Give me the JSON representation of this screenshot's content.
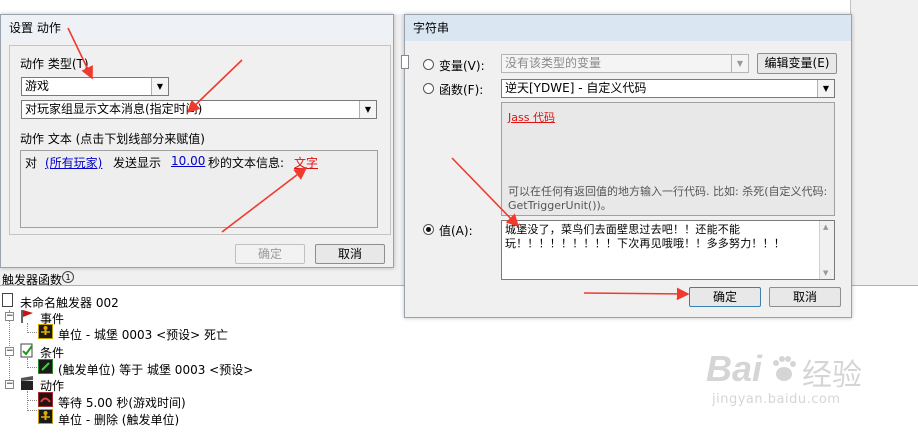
{
  "action_dialog": {
    "title": "设置 动作",
    "type_label": "动作 类型(T)",
    "type_value": "游戏",
    "action_value": "对玩家组显示文本消息(指定时间)",
    "text_label": "动作 文本 (点击下划线部分来赋值)",
    "text_prefix": "对",
    "text_players": "(所有玩家)",
    "text_mid": "发送显示",
    "text_seconds": "10.00",
    "text_after": "秒的文本信息:",
    "text_value": "文字",
    "ok_label": "确定",
    "cancel_label": "取消"
  },
  "string_dialog": {
    "title": "字符串",
    "var_label": "变量(V):",
    "var_value": "没有该类型的变量",
    "edit_var_label": "编辑变量(E)",
    "func_label": "函数(F):",
    "func_value": "逆天[YDWE] - 自定义代码",
    "jass_link": "Jass 代码",
    "desc_text": "可以在任何有返回值的地方输入一行代码. 比如: 杀死(自定义代码: GetTriggerUnit())。",
    "value_label": "值(A):",
    "value_text": "城堡没了，菜鸟们去面壁思过去吧！！还能不能玩！！！！！！！！！下次再见哦哦！！多多努力！！！",
    "ok_label": "确定",
    "cancel_label": "取消"
  },
  "trigger_panel": {
    "header": "触发器函数",
    "trigger_name": "未命名触发器 002",
    "events_label": "事件",
    "event_item": "单位 - 城堡 0003 <预设> 死亡",
    "conditions_label": "条件",
    "condition_item": "(触发单位) 等于 城堡 0003 <预设>",
    "actions_label": "动作",
    "action_item_1": "等待 5.00 秒(游戏时间)",
    "action_item_2": "单位 - 删除 (触发单位)"
  },
  "watermark": {
    "brand": "Bai",
    "brand_cn": "经验",
    "url": "jingyan.baidu.com"
  },
  "colors": {
    "annotation_arrow": "#f03a2e",
    "link_blue": "#0000cc",
    "text_red": "#e01010"
  }
}
